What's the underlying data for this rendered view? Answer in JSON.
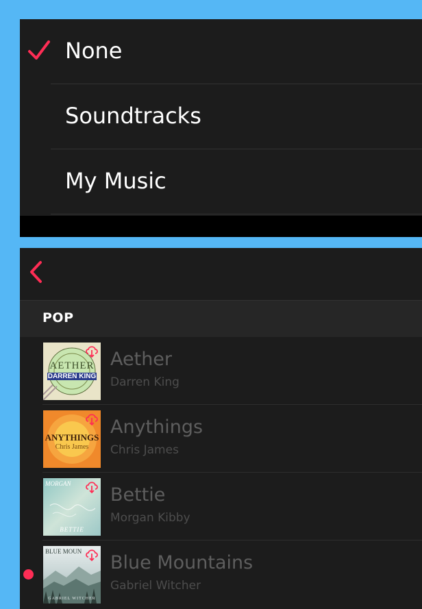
{
  "options": [
    {
      "label": "None",
      "selected": true
    },
    {
      "label": "Soundtracks",
      "selected": false
    },
    {
      "label": "My Music",
      "selected": false
    }
  ],
  "section_title": "POP",
  "songs": [
    {
      "title": "Aether",
      "artist": "Darren King",
      "art_text": "AETHER",
      "art_text2": "DARREN KING",
      "now_playing": false
    },
    {
      "title": "Anythings",
      "artist": "Chris James",
      "art_text": "ANYTHINGS",
      "art_text2": "Chris James",
      "now_playing": false
    },
    {
      "title": "Bettie",
      "artist": "Morgan Kibby",
      "art_text": "MORGAN",
      "art_text2": "BETTIE",
      "now_playing": false
    },
    {
      "title": "Blue Mountains",
      "artist": "Gabriel Witcher",
      "art_text": "BLUE MOUN",
      "art_text2": "GABRIEL WITCHER",
      "now_playing": true
    }
  ],
  "colors": {
    "accent": "#ff2d55",
    "background": "#1c1c1c",
    "frame": "#55b7f5"
  },
  "icons": {
    "check": "checkmark-icon",
    "back": "chevron-left-icon",
    "cloud": "cloud-download-icon"
  }
}
